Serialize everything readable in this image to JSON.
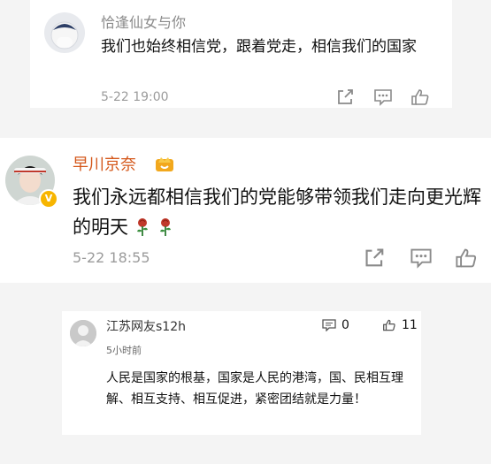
{
  "comments": [
    {
      "author": "恰逢仙女与你",
      "text": "我们也始终相信党，跟着党走，相信我们的国家",
      "time": "5-22 19:00"
    },
    {
      "author": "早川京奈",
      "text": "我们永远都相信我们的党能够带领我们走向更光辉的明天",
      "time": "5-22 18:55"
    },
    {
      "author": "江苏网友s12h",
      "subtitle": "5小时前",
      "text": "人民是国家的根基，国家是人民的港湾，国、民相互理解、相互支持、相互促进，紧密团结就是力量！",
      "comment_count": "0",
      "like_count": "11"
    }
  ],
  "colors": {
    "vip_name": "#d4571a",
    "muted": "#9b9b9b",
    "background": "#f4f4f4"
  },
  "icons": [
    "share-icon",
    "comment-icon",
    "like-icon",
    "rose-emoji",
    "verified-badge",
    "rank-badge"
  ]
}
